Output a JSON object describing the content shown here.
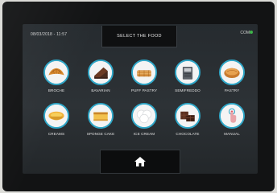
{
  "status": {
    "datetime": "08/03/2018 - 11:57",
    "connection": "COM"
  },
  "header": {
    "title": "SELECT THE FOOD"
  },
  "foods": [
    {
      "label": "BROCHE",
      "icon": "croissant-icon"
    },
    {
      "label": "BAVARIAN",
      "icon": "bavarian-cake-icon"
    },
    {
      "label": "PUFF PASTRY",
      "icon": "puff-pastry-icon"
    },
    {
      "label": "SEMIFREDDO",
      "icon": "semifreddo-icon"
    },
    {
      "label": "PASTRY",
      "icon": "tart-icon"
    },
    {
      "label": "CREAMS",
      "icon": "cream-bowl-icon"
    },
    {
      "label": "SPONGE CAKE",
      "icon": "sponge-cake-icon"
    },
    {
      "label": "ICE CREAM",
      "icon": "ice-cream-icon"
    },
    {
      "label": "CHOCOLATE",
      "icon": "chocolate-icon"
    },
    {
      "label": "MANUAL",
      "icon": "manual-touch-icon"
    }
  ],
  "footer": {
    "home_icon": "home-icon"
  },
  "colors": {
    "accent": "#2fa7c8",
    "status_ok": "#3fb54a",
    "screen_bg": "#2a2f33"
  }
}
